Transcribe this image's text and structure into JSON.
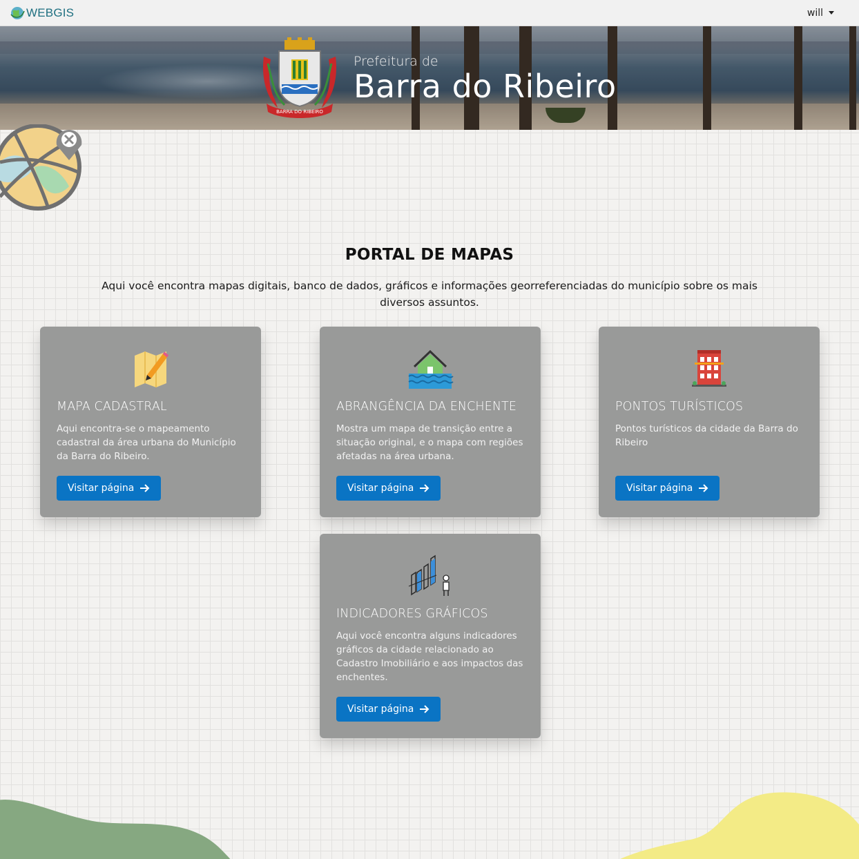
{
  "navbar": {
    "brand": "WEBGIS",
    "user": "will"
  },
  "banner": {
    "pre_title": "Prefeitura de",
    "title": "Barra do Ribeiro",
    "crest_ribbon": "BARRA DO RIBEIRO"
  },
  "intro": {
    "title": "PORTAL DE MAPAS",
    "description": "Aqui você encontra mapas digitais, banco de dados, gráficos e informações georreferenciadas do município sobre os mais diversos assuntos."
  },
  "cards": [
    {
      "icon": "map-pencil-icon",
      "title": "MAPA CADASTRAL",
      "text": "Aqui encontra-se o mapeamento cadastral da área urbana do Município da Barra do Ribeiro.",
      "button": "Visitar página"
    },
    {
      "icon": "flooded-house-icon",
      "title": "ABRANGÊNCIA DA ENCHENTE",
      "text": "Mostra um mapa de transição entre a situação original, e o mapa com regiões afetadas na área urbana.",
      "button": "Visitar página"
    },
    {
      "icon": "building-icon",
      "title": "PONTOS TURÍSTICOS",
      "text": "Pontos turísticos da cidade da Barra do Ribeiro",
      "button": "Visitar página"
    },
    {
      "icon": "bar-chart-person-icon",
      "title": "INDICADORES GRÁFICOS",
      "text": "Aqui você encontra alguns indicadores gráficos da cidade relacionado ao Cadastro Imobiliário e aos impactos das enchentes.",
      "button": "Visitar página"
    }
  ],
  "colors": {
    "card_bg": "#999a99",
    "button_bg": "#0a74c4",
    "brand": "#1e6f80",
    "blob_green": "#86a881",
    "blob_yellow": "#f3eb86"
  }
}
